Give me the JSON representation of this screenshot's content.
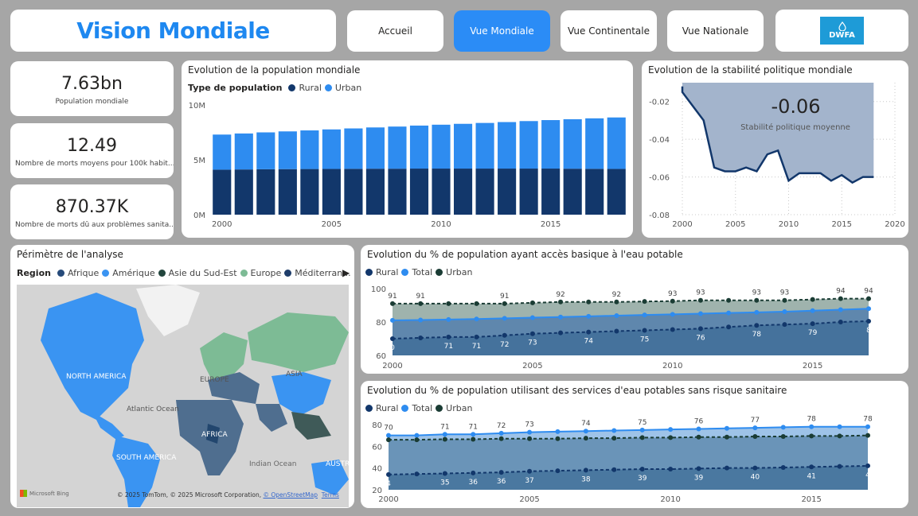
{
  "header": {
    "title": "Vision Mondiale",
    "nav": [
      "Accueil",
      "Vue Mondiale",
      "Vue Continentale",
      "Vue Nationale"
    ],
    "logo_text": "DWFA"
  },
  "kpis": [
    {
      "value": "7.63bn",
      "label": "Population mondiale"
    },
    {
      "value": "12.49",
      "label": "Nombre de morts moyens pour 100k habit..."
    },
    {
      "value": "870.37K",
      "label": "Nombre de morts dû aux problèmes sanita..."
    }
  ],
  "population_chart": {
    "title": "Evolution de la population mondiale",
    "legend_title": "Type de population",
    "legend": [
      "Rural",
      "Urban"
    ]
  },
  "stability_chart": {
    "title": "Evolution de la stabilité politique mondiale",
    "card_value": "-0.06",
    "card_label": "Stabilité politique moyenne"
  },
  "map": {
    "title": "Périmètre de l'analyse",
    "legend_title": "Region",
    "legend": [
      "Afrique",
      "Amérique",
      "Asie du Sud-Est",
      "Europe",
      "Méditerran..."
    ],
    "labels": [
      "NORTH AMERICA",
      "EUROPE",
      "ASIA",
      "Atlantic Ocean",
      "AFRICA",
      "SOUTH AMERICA",
      "Indian Ocean",
      "AUSTRAL"
    ],
    "bing": "Microsoft Bing",
    "copyright": "© 2025 TomTom, © 2025 Microsoft Corporation, ",
    "osm": "© OpenStreetMap",
    "terms": "Terms"
  },
  "water_basic_chart": {
    "title": "Evolution du % de population ayant accès basique à l'eau potable",
    "legend": [
      "Rural",
      "Total",
      "Urban"
    ]
  },
  "water_safe_chart": {
    "title": "Evolution du % de population utilisant des services d'eau potables sans risque sanitaire",
    "legend": [
      "Rural",
      "Total",
      "Urban"
    ]
  },
  "colors": {
    "rural": "#12376b",
    "urban": "#2e8cf0",
    "total": "#2e8cf0",
    "urban_dark": "#1a3c34",
    "accent": "#1e88f0"
  },
  "chart_data": [
    {
      "type": "bar",
      "title": "Evolution de la population mondiale",
      "categories": [
        2000,
        2001,
        2002,
        2003,
        2004,
        2005,
        2006,
        2007,
        2008,
        2009,
        2010,
        2011,
        2012,
        2013,
        2014,
        2015,
        2016,
        2017,
        2018
      ],
      "series": [
        {
          "name": "Rural",
          "values": [
            4.1,
            4.12,
            4.14,
            4.15,
            4.16,
            4.17,
            4.18,
            4.19,
            4.19,
            4.2,
            4.2,
            4.2,
            4.2,
            4.2,
            4.2,
            4.2,
            4.19,
            4.18,
            4.17
          ]
        },
        {
          "name": "Urban",
          "values": [
            3.2,
            3.28,
            3.36,
            3.44,
            3.52,
            3.6,
            3.68,
            3.76,
            3.84,
            3.92,
            4.0,
            4.08,
            4.16,
            4.24,
            4.33,
            4.42,
            4.51,
            4.6,
            4.69
          ]
        }
      ],
      "ylim": [
        0,
        10
      ],
      "yticks": [
        "0M",
        "5M",
        "10M"
      ],
      "xticks": [
        "2000",
        "2005",
        "2010",
        "2015"
      ],
      "stacked": true
    },
    {
      "type": "area",
      "title": "Evolution de la stabilité politique mondiale",
      "x": [
        1996,
        1998,
        2000,
        2002,
        2003,
        2004,
        2005,
        2006,
        2007,
        2008,
        2009,
        2010,
        2011,
        2012,
        2013,
        2014,
        2015,
        2016,
        2017,
        2018
      ],
      "values": [
        -0.012,
        -0.013,
        -0.015,
        -0.03,
        -0.055,
        -0.057,
        -0.057,
        -0.055,
        -0.057,
        -0.048,
        -0.046,
        -0.062,
        -0.058,
        -0.058,
        -0.058,
        -0.062,
        -0.059,
        -0.063,
        -0.06,
        -0.06
      ],
      "xlim": [
        2000,
        2020
      ],
      "ylim": [
        -0.08,
        -0.01
      ],
      "yticks": [
        "-0.02",
        "-0.04",
        "-0.06",
        "-0.08"
      ],
      "xticks": [
        "2000",
        "2005",
        "2010",
        "2015",
        "2020"
      ]
    },
    {
      "type": "line",
      "title": "Evolution du % de population ayant accès basique à l'eau potable",
      "x": [
        2000,
        2001,
        2002,
        2003,
        2004,
        2005,
        2006,
        2007,
        2008,
        2009,
        2010,
        2011,
        2012,
        2013,
        2014,
        2015,
        2016,
        2017
      ],
      "series": [
        {
          "name": "Rural",
          "values": [
            70,
            70.5,
            71,
            71,
            72,
            73,
            73.5,
            74,
            74.5,
            75,
            75.5,
            76,
            77,
            78,
            78.5,
            79,
            80,
            80.5
          ]
        },
        {
          "name": "Total",
          "values": [
            81,
            81.2,
            81.5,
            81.8,
            82.2,
            82.6,
            83,
            83.4,
            83.8,
            84.2,
            84.6,
            85,
            85.4,
            85.8,
            86.2,
            86.8,
            87.4,
            88
          ]
        },
        {
          "name": "Urban",
          "values": [
            91,
            91,
            91,
            91,
            91,
            91.5,
            92,
            92,
            92,
            92.3,
            92.5,
            93,
            93,
            93,
            93,
            93.5,
            94,
            94
          ]
        }
      ],
      "data_labels": {
        "Rural": [
          [
            0,
            "0"
          ],
          [
            2,
            "71"
          ],
          [
            3,
            "71"
          ],
          [
            4,
            "72"
          ],
          [
            5,
            "73"
          ],
          [
            7,
            "74"
          ],
          [
            9,
            "75"
          ],
          [
            11,
            "76"
          ],
          [
            13,
            "78"
          ],
          [
            15,
            "79"
          ],
          [
            17,
            "8"
          ]
        ],
        "Urban": [
          [
            0,
            "91"
          ],
          [
            1,
            "91"
          ],
          [
            4,
            "91"
          ],
          [
            6,
            "92"
          ],
          [
            8,
            "92"
          ],
          [
            10,
            "93"
          ],
          [
            11,
            "93"
          ],
          [
            13,
            "93"
          ],
          [
            14,
            "93"
          ],
          [
            16,
            "94"
          ],
          [
            17,
            "94"
          ]
        ]
      },
      "ylim": [
        60,
        100
      ],
      "yticks": [
        "60",
        "80",
        "100"
      ],
      "xticks": [
        "2000",
        "2005",
        "2010",
        "2015"
      ]
    },
    {
      "type": "line",
      "title": "Evolution du % de population utilisant des services d'eau potables sans risque sanitaire",
      "x": [
        2000,
        2001,
        2002,
        2003,
        2004,
        2005,
        2006,
        2007,
        2008,
        2009,
        2010,
        2011,
        2012,
        2013,
        2014,
        2015,
        2016,
        2017
      ],
      "series": [
        {
          "name": "Rural",
          "values": [
            34,
            34.5,
            35,
            35.5,
            36,
            37,
            37.5,
            38,
            38.5,
            39,
            39,
            39.5,
            40,
            40,
            40.5,
            41,
            41.5,
            42
          ]
        },
        {
          "name": "Total",
          "values": [
            70,
            70,
            71,
            71,
            72,
            73,
            73.5,
            74,
            74.5,
            75,
            75.5,
            76,
            76.5,
            77,
            77.5,
            78,
            78,
            78
          ]
        },
        {
          "name": "Urban",
          "values": [
            66,
            66,
            66.5,
            66.5,
            67,
            67,
            67,
            67.5,
            67.5,
            68,
            68,
            68.5,
            68.5,
            69,
            69,
            69.5,
            69.5,
            70
          ]
        }
      ],
      "data_labels": {
        "Rural": [
          [
            0,
            "4"
          ],
          [
            2,
            "35"
          ],
          [
            3,
            "36"
          ],
          [
            4,
            "36"
          ],
          [
            5,
            "37"
          ],
          [
            7,
            "38"
          ],
          [
            9,
            "39"
          ],
          [
            11,
            "39"
          ],
          [
            13,
            "40"
          ],
          [
            15,
            "41"
          ],
          [
            17,
            "4"
          ]
        ],
        "Total": [
          [
            0,
            "70"
          ],
          [
            2,
            "71"
          ],
          [
            3,
            "71"
          ],
          [
            4,
            "72"
          ],
          [
            5,
            "73"
          ],
          [
            7,
            "74"
          ],
          [
            9,
            "75"
          ],
          [
            11,
            "76"
          ],
          [
            13,
            "77"
          ],
          [
            15,
            "78"
          ],
          [
            17,
            "78"
          ]
        ]
      },
      "ylim": [
        20,
        80
      ],
      "yticks": [
        "20",
        "40",
        "60",
        "80"
      ],
      "xticks": [
        "2000",
        "2005",
        "2010",
        "2015"
      ]
    }
  ]
}
